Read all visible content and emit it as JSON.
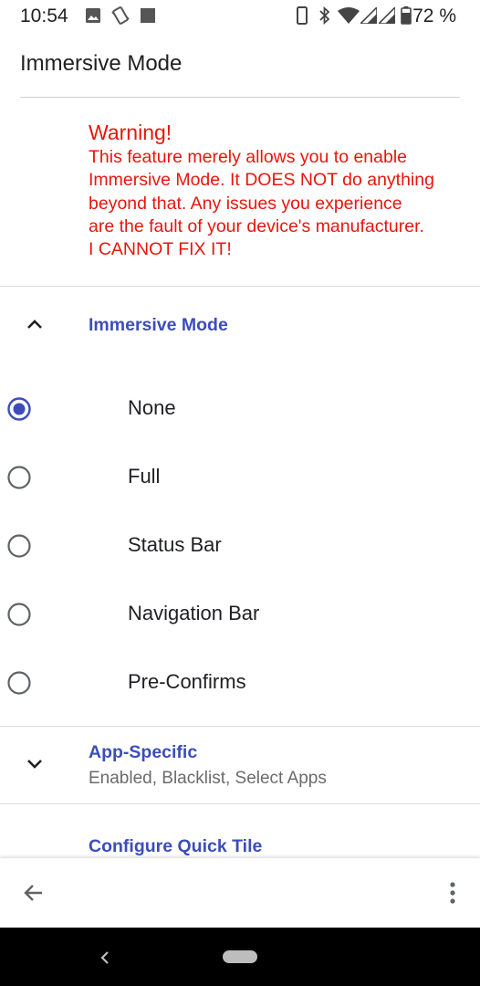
{
  "status_bar": {
    "time": "10:54",
    "battery": "72 %",
    "left_icons": [
      "image-icon",
      "vibrate-icon",
      "square-notification-icon"
    ],
    "right_icons": [
      "phone-outline-icon",
      "bluetooth-icon",
      "wifi-icon",
      "signal-icon",
      "signal-icon",
      "battery-icon"
    ]
  },
  "header": {
    "title": "Immersive Mode"
  },
  "warning": {
    "title": "Warning!",
    "lines": [
      "This feature merely allows you to enable",
      "Immersive Mode. It DOES NOT do anything",
      "beyond that. Any issues you experience",
      "are the fault of your device's manufacturer.",
      "I CANNOT FIX IT!"
    ],
    "color": "#e8160c"
  },
  "immersive_section": {
    "title": "Immersive Mode",
    "expanded": true,
    "options": [
      "None",
      "Full",
      "Status Bar",
      "Navigation Bar",
      "Pre-Confirms"
    ],
    "selected": "None"
  },
  "app_specific": {
    "title": "App-Specific",
    "subtitle": "Enabled, Blacklist, Select Apps",
    "expanded": false
  },
  "quick_tile": {
    "title": "Configure Quick Tile"
  },
  "colors": {
    "accent": "#3c4dbb",
    "warning": "#e8160c"
  }
}
